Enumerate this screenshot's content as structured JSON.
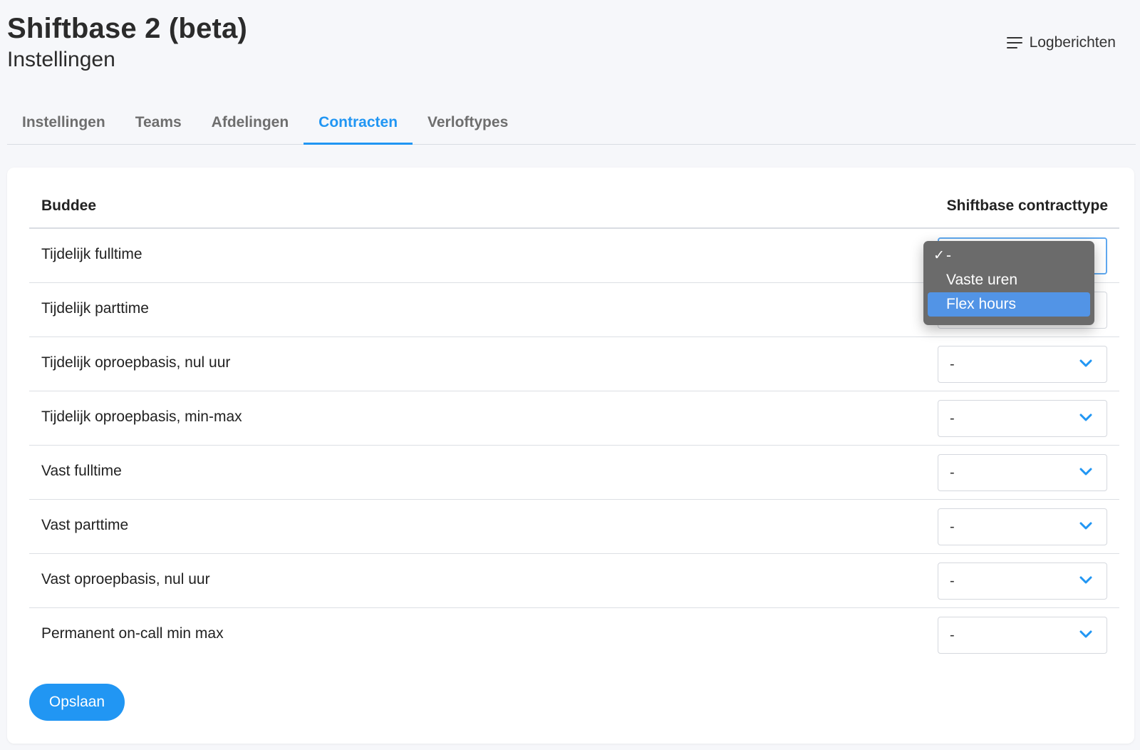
{
  "header": {
    "title": "Shiftbase 2 (beta)",
    "subtitle": "Instellingen",
    "log_button_label": "Logberichten",
    "log_icon": "menu-lines-icon"
  },
  "tabs": [
    {
      "label": "Instellingen",
      "active": false
    },
    {
      "label": "Teams",
      "active": false
    },
    {
      "label": "Afdelingen",
      "active": false
    },
    {
      "label": "Contracten",
      "active": true
    },
    {
      "label": "Verloftypes",
      "active": false
    }
  ],
  "table": {
    "col_buddee": "Buddee",
    "col_shiftbase": "Shiftbase contracttype",
    "rows": [
      {
        "label": "Tijdelijk fulltime",
        "value": "-"
      },
      {
        "label": "Tijdelijk parttime",
        "value": "-"
      },
      {
        "label": "Tijdelijk oproepbasis, nul uur",
        "value": "-"
      },
      {
        "label": "Tijdelijk oproepbasis, min-max",
        "value": "-"
      },
      {
        "label": "Vast fulltime",
        "value": "-"
      },
      {
        "label": "Vast parttime",
        "value": "-"
      },
      {
        "label": "Vast oproepbasis, nul uur",
        "value": "-"
      },
      {
        "label": "Permanent on-call min max",
        "value": "-"
      }
    ]
  },
  "dropdown": {
    "check_mark": "✓",
    "options": [
      {
        "label": "-",
        "selected": true,
        "highlighted": false
      },
      {
        "label": "Vaste uren",
        "selected": false,
        "highlighted": false
      },
      {
        "label": "Flex hours",
        "selected": false,
        "highlighted": true
      }
    ]
  },
  "save_button_label": "Opslaan",
  "colors": {
    "accent": "#2196f3",
    "dropdown_bg": "#6b6b6b",
    "dropdown_highlight": "#5294e6",
    "page_bg": "#f6f7fa"
  }
}
